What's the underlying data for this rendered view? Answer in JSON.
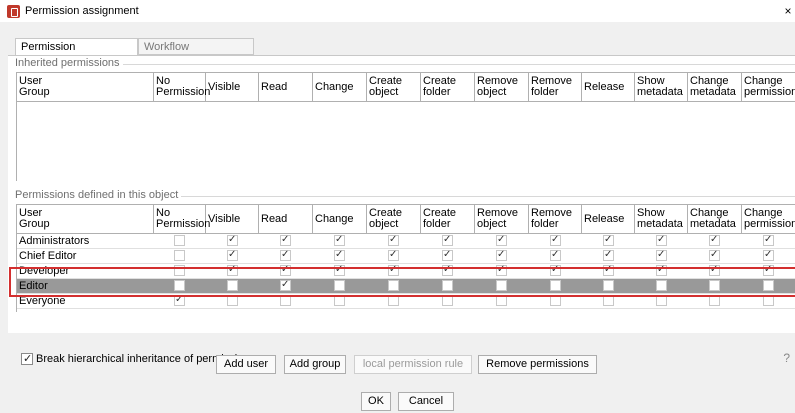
{
  "window": {
    "title": "Permission assignment",
    "close_glyph": "×"
  },
  "tabs": [
    {
      "label": "Permission assignment",
      "active": true
    },
    {
      "label": "Workflow permissions",
      "active": false
    }
  ],
  "columns": [
    "User\nGroup",
    "No\nPermission",
    "Visible",
    "Read",
    "Change",
    "Create\nobject",
    "Create\nfolder",
    "Remove\nobject",
    "Remove\nfolder",
    "Release",
    "Show\nmetadata",
    "Change\nmetadata",
    "Change\npermission"
  ],
  "inherited": {
    "label": "Inherited permissions",
    "rows": []
  },
  "defined": {
    "label": "Permissions defined in this object",
    "rows": [
      {
        "name": "Administrators",
        "checks": [
          false,
          true,
          true,
          true,
          true,
          true,
          true,
          true,
          true,
          true,
          true,
          true
        ],
        "selected": false
      },
      {
        "name": "Chief Editor",
        "checks": [
          false,
          true,
          true,
          true,
          true,
          true,
          true,
          true,
          true,
          true,
          true,
          true
        ],
        "selected": false
      },
      {
        "name": "Developer",
        "checks": [
          false,
          true,
          true,
          true,
          true,
          true,
          true,
          true,
          true,
          true,
          true,
          true
        ],
        "selected": false
      },
      {
        "name": "Editor",
        "checks": [
          false,
          false,
          true,
          false,
          false,
          false,
          false,
          false,
          false,
          false,
          false,
          false
        ],
        "selected": true
      },
      {
        "name": "Everyone",
        "checks": [
          true,
          false,
          false,
          false,
          false,
          false,
          false,
          false,
          false,
          false,
          false,
          false
        ],
        "selected": false
      }
    ]
  },
  "break_inheritance": {
    "label": "Break hierarchical inheritance of permissions",
    "checked": true
  },
  "help_glyph": "?",
  "buttons": {
    "add_user": "Add user",
    "add_group": "Add group",
    "local_rule": "local permission rule",
    "remove": "Remove permissions",
    "ok": "OK",
    "cancel": "Cancel"
  },
  "colors": {
    "selected_row": "#999999",
    "highlight": "#d32f2f",
    "app_icon": "#c0392b"
  }
}
